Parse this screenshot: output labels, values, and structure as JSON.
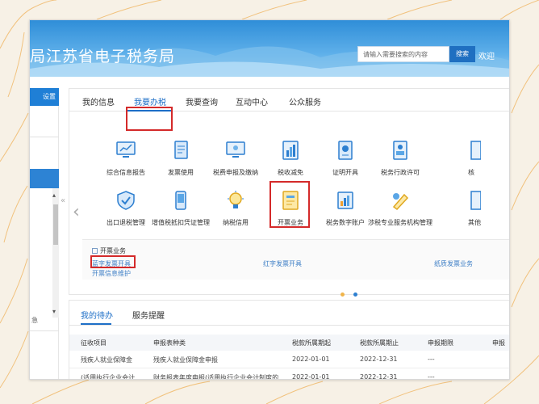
{
  "header": {
    "title": "局江苏省电子税务局",
    "search_placeholder": "请输入需要搜索的内容",
    "search_button": "搜索",
    "welcome": "欢迎"
  },
  "left": {
    "settings": "设置",
    "snippet": "急"
  },
  "tabs": [
    "我的信息",
    "我要办税",
    "我要查询",
    "互动中心",
    "公众服务"
  ],
  "active_tab": "我要办税",
  "services_row1": [
    {
      "label": "综合信息报告",
      "icon": "monitor-chart-icon"
    },
    {
      "label": "发票使用",
      "icon": "document-icon"
    },
    {
      "label": "税费申报及缴纳",
      "icon": "monitor-icon"
    },
    {
      "label": "税收减免",
      "icon": "bar-chart-icon"
    },
    {
      "label": "证明开具",
      "icon": "certificate-icon"
    },
    {
      "label": "税务行政许可",
      "icon": "id-card-icon"
    },
    {
      "label": "核",
      "icon": "partial-icon"
    }
  ],
  "services_row2": [
    {
      "label": "出口退税管理",
      "icon": "shield-icon"
    },
    {
      "label": "增值税抵扣凭证管理",
      "icon": "phone-icon"
    },
    {
      "label": "纳税信用",
      "icon": "lightbulb-icon"
    },
    {
      "label": "开票业务",
      "icon": "invoice-icon"
    },
    {
      "label": "税务数字账户",
      "icon": "ledger-icon"
    },
    {
      "label": "涉税专业服务机构管理",
      "icon": "pen-icon"
    },
    {
      "label": "其他",
      "icon": "partial-icon"
    }
  ],
  "invoice_panel": {
    "title": "开票业务",
    "links": [
      "蓝字发票开具",
      "红字发票开具",
      "纸质发票业务",
      "开票信息维护"
    ]
  },
  "todo": {
    "tabs": [
      "我的待办",
      "服务提醒"
    ],
    "columns": [
      "征收项目",
      "申报表种类",
      "税款所属期起",
      "税款所属期止",
      "申报期限",
      "申报"
    ],
    "rows": [
      [
        "残疾人就业保障金",
        "残疾人就业保障金申报",
        "2022-01-01",
        "2022-12-31",
        "---",
        ""
      ],
      [
        "(适用执行企业会计...",
        "财务报表年度申报(适用执行企业会计制度的...",
        "2022-01-01",
        "2022-12-31",
        "---",
        ""
      ]
    ]
  },
  "colors": {
    "primary": "#1e6fc7",
    "highlight": "#d42a2a",
    "banner": "#2f8ed8"
  }
}
